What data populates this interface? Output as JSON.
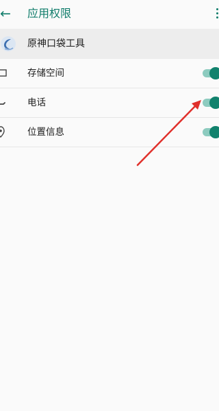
{
  "toolbar": {
    "title": "应用权限",
    "back_icon": "arrow-left-icon",
    "menu_icon": "more-vertical-icon"
  },
  "app": {
    "name": "原神口袋工具",
    "icon": "app-icon"
  },
  "permissions": [
    {
      "label": "存储空间",
      "icon": "folder-icon",
      "enabled": true
    },
    {
      "label": "电话",
      "icon": "phone-icon",
      "enabled": true
    },
    {
      "label": "位置信息",
      "icon": "location-pin-icon",
      "enabled": true
    }
  ],
  "colors": {
    "accent": "#0f7c6a",
    "toggle_thumb": "#11826d",
    "toggle_track": "#8dcbbf",
    "annotation_arrow": "#e0302b"
  }
}
